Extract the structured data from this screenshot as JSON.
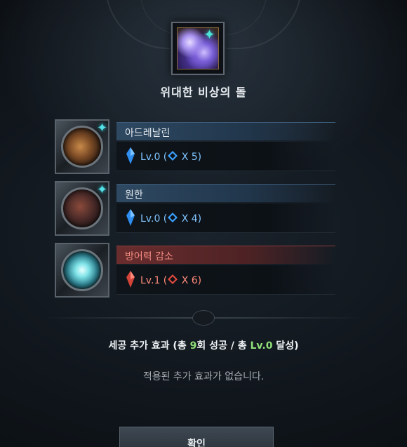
{
  "header": {
    "item_name": "위대한 비상의 돌"
  },
  "rows": [
    {
      "name": "아드레날린",
      "level_text": "Lv.0 (",
      "count_text": " X 5)",
      "color": "blue",
      "has_sparkle": true
    },
    {
      "name": "원한",
      "level_text": "Lv.0 (",
      "count_text": " X 4)",
      "color": "blue",
      "has_sparkle": true
    },
    {
      "name": "방어력 감소",
      "level_text": "Lv.1 (",
      "count_text": " X 6)",
      "color": "red",
      "has_sparkle": false
    }
  ],
  "bonus": {
    "prefix": "세공 추가 효과 (총 ",
    "success_count": "9",
    "middle": "회 성공 / 총 ",
    "level": "Lv.0",
    "suffix": " 달성)"
  },
  "bonus_empty": "적용된 추가 효과가 없습니다.",
  "confirm_label": "확인",
  "colors": {
    "blue_accent": "#7fc4ff",
    "red_accent": "#ff8a7a",
    "highlight_green": "#8fe07a",
    "sparkle": "#53e0e6"
  },
  "icons": {
    "gem_blue": "blue-crystal-icon",
    "gem_red": "red-crystal-icon",
    "sparkle": "sparkle-icon"
  }
}
